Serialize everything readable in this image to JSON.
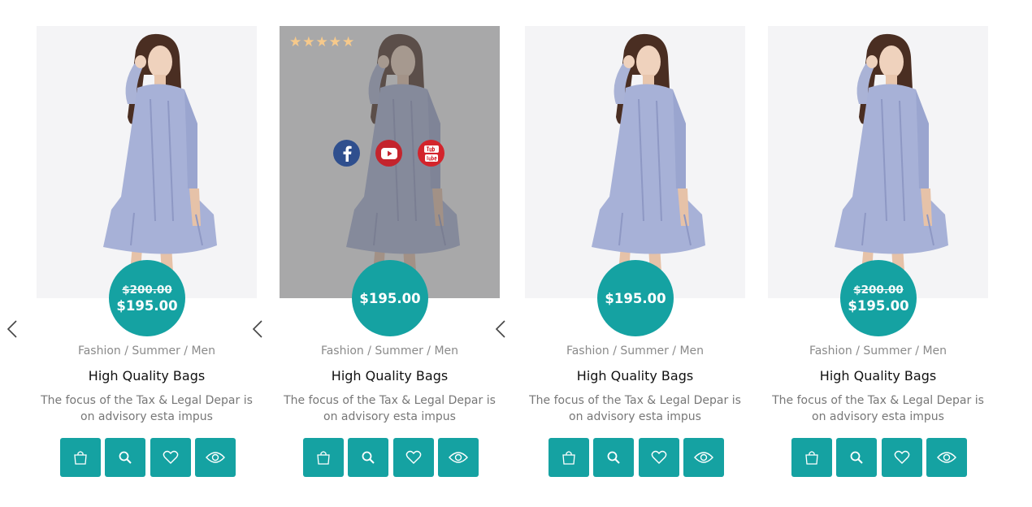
{
  "products": [
    {
      "old_price": "$200.00",
      "price": "$195.00",
      "categories": [
        "Fashion",
        "Summer",
        "Men"
      ],
      "title": "High Quality Bags",
      "desc_line1": "The focus of the Tax & Legal Depar is",
      "desc_line2": "on advisory esta impus"
    },
    {
      "old_price": "",
      "price": "$195.00",
      "categories": [
        "Fashion",
        "Summer",
        "Men"
      ],
      "title": "High Quality Bags",
      "desc_line1": "The focus of the Tax & Legal Depar is",
      "desc_line2": "on advisory esta impus",
      "rating_stars": "★★★★★",
      "hover": true
    },
    {
      "old_price": "",
      "price": "$195.00",
      "categories": [
        "Fashion",
        "Summer",
        "Men"
      ],
      "title": "High Quality Bags",
      "desc_line1": "The focus of the Tax & Legal Depar is",
      "desc_line2": "on advisory esta impus"
    },
    {
      "old_price": "$200.00",
      "price": "$195.00",
      "categories": [
        "Fashion",
        "Summer",
        "Men"
      ],
      "title": "High Quality Bags",
      "desc_line1": "The focus of the Tax & Legal Depar is",
      "desc_line2": "on advisory esta impus"
    }
  ],
  "category_separator": "/",
  "social_icons": [
    "facebook-icon",
    "youtube-icon",
    "youtube-logo-icon"
  ],
  "action_icons": [
    "shopping-bag-icon",
    "search-icon",
    "heart-icon",
    "eye-icon"
  ],
  "navigation": [
    "chevron-left-icon"
  ],
  "colors": {
    "accent": "#15a2a2",
    "star": "#f6c98b",
    "facebook": "#2f4f8e",
    "youtube": "#c4242d"
  }
}
